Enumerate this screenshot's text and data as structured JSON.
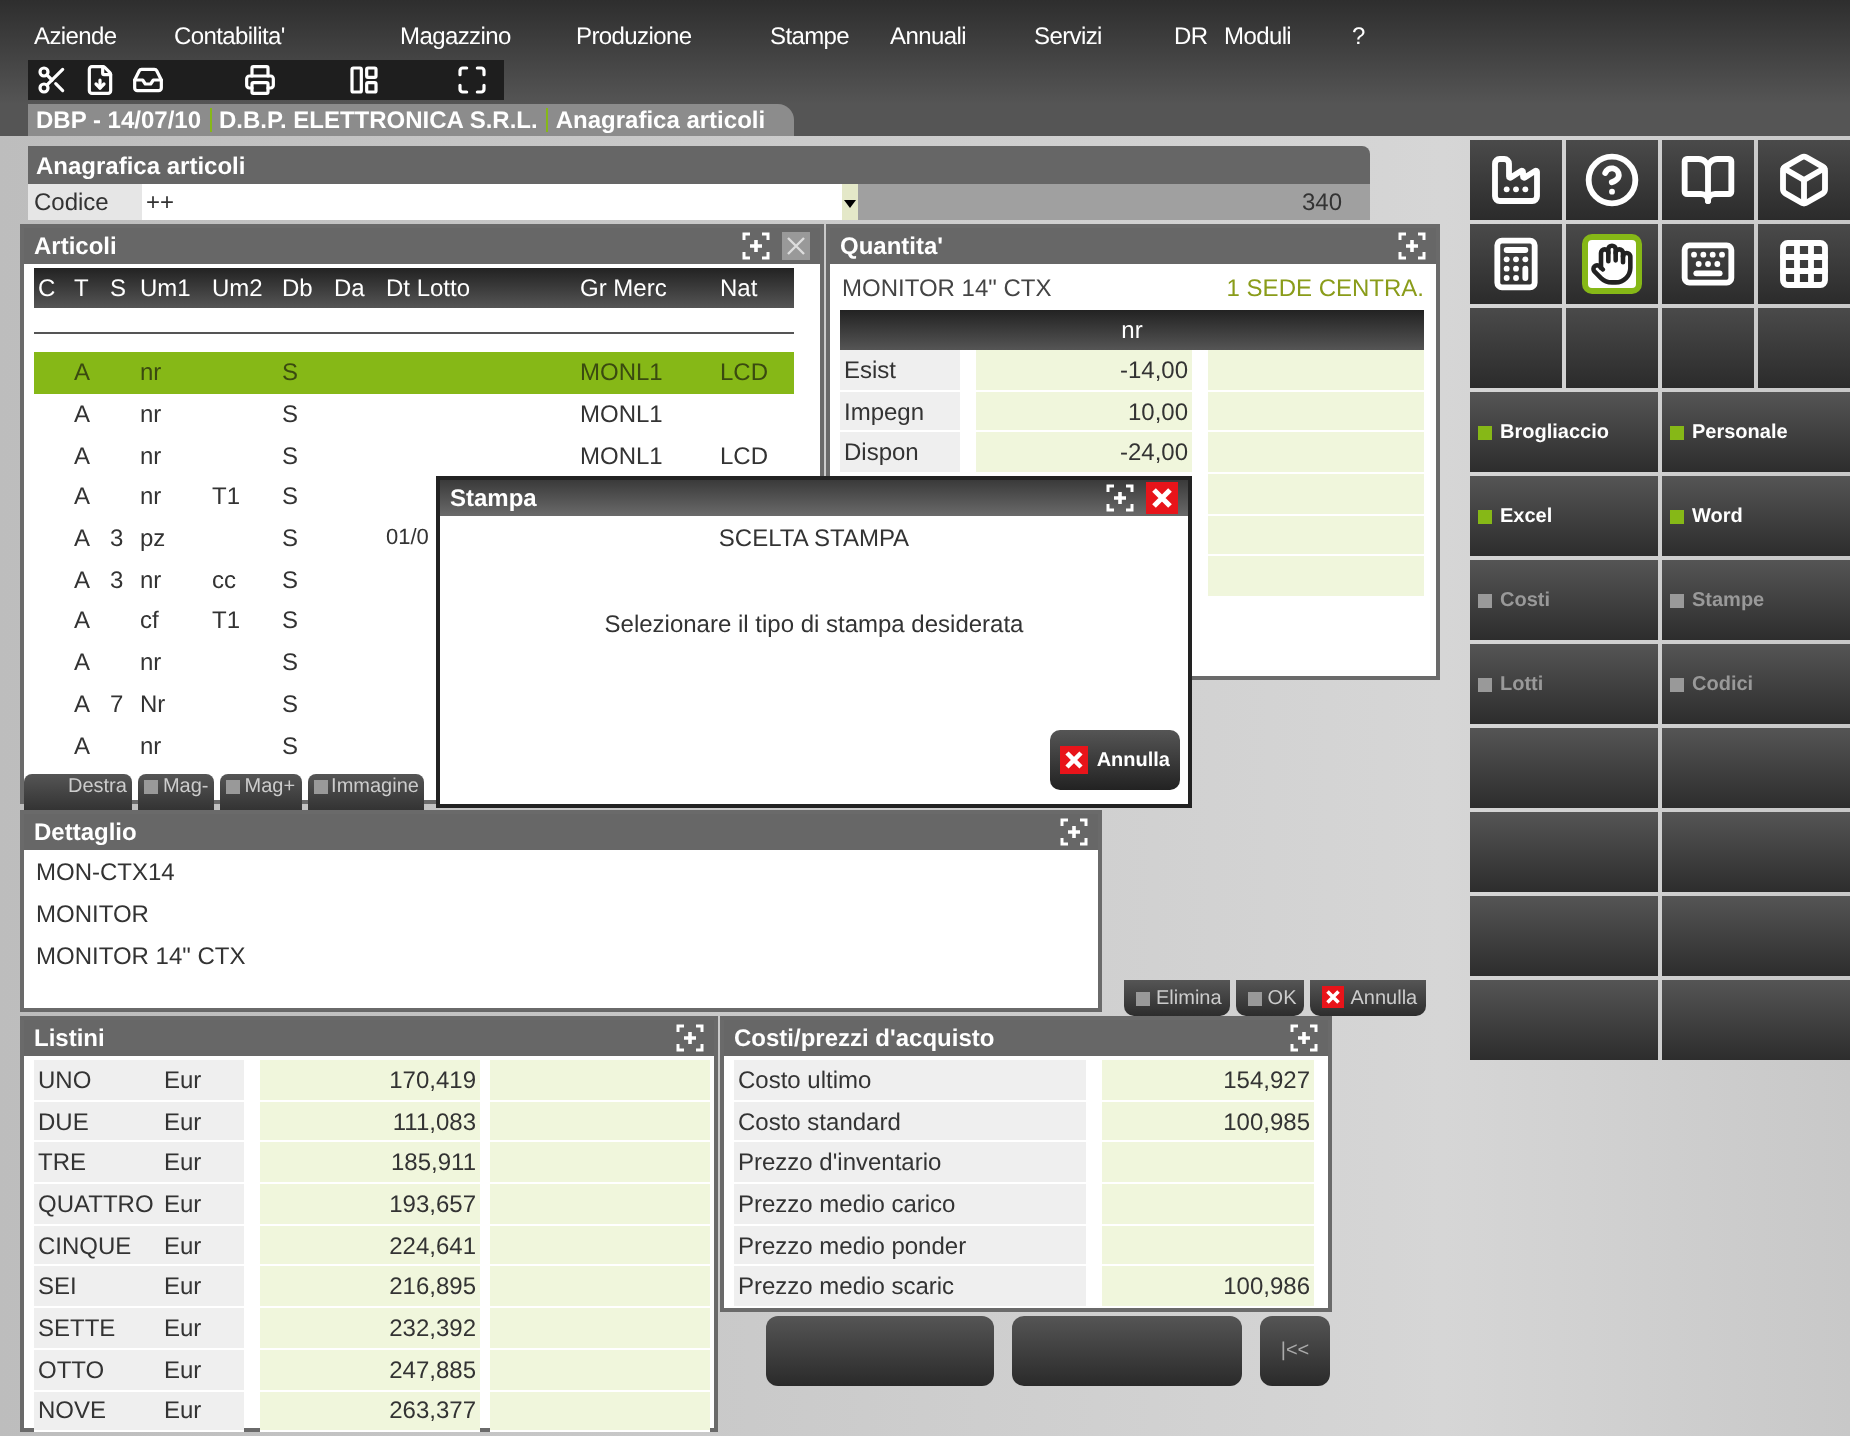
{
  "menu": [
    "Aziende",
    "Contabilita'",
    "Magazzino",
    "Produzione",
    "Stampe",
    "Annuali",
    "Servizi",
    "DR",
    "Moduli",
    "?"
  ],
  "breadcrumb": [
    "DBP - 14/07/10",
    "D.B.P. ELETTRONICA S.R.L.",
    "Anagrafica articoli"
  ],
  "form": {
    "title": "Anagrafica articoli",
    "code_label": "Codice",
    "code_value": "++",
    "count": "340"
  },
  "articoli": {
    "title": "Articoli",
    "columns": [
      "C",
      "T",
      "S",
      "Um1",
      "Um2",
      "Db",
      "Da",
      "Dt Lotto",
      "Gr Merc",
      "Nat"
    ],
    "rows": [
      {
        "selected": true,
        "cells": [
          null,
          "A",
          null,
          "nr",
          null,
          "S",
          null,
          null,
          "MONL1",
          "LCD"
        ]
      },
      {
        "selected": false,
        "cells": [
          null,
          "A",
          null,
          "nr",
          null,
          "S",
          null,
          null,
          "MONL1",
          null
        ]
      },
      {
        "selected": false,
        "cells": [
          null,
          "A",
          null,
          "nr",
          null,
          "S",
          null,
          null,
          "MONL1",
          "LCD"
        ]
      },
      {
        "selected": false,
        "cells": [
          null,
          "A",
          null,
          "nr",
          "T1",
          "S"
        ]
      },
      {
        "selected": false,
        "cells": [
          null,
          "A",
          "3",
          "pz",
          null,
          "S",
          null,
          "01/0"
        ]
      },
      {
        "selected": false,
        "cells": [
          null,
          "A",
          "3",
          "nr",
          "cc",
          "S"
        ]
      },
      {
        "selected": false,
        "cells": [
          null,
          "A",
          null,
          "cf",
          "T1",
          "S"
        ]
      },
      {
        "selected": false,
        "cells": [
          null,
          "A",
          null,
          "nr",
          null,
          "S"
        ]
      },
      {
        "selected": false,
        "cells": [
          null,
          "A",
          "7",
          "Nr",
          null,
          "S"
        ]
      },
      {
        "selected": false,
        "cells": [
          null,
          "A",
          null,
          "nr",
          null,
          "S"
        ]
      }
    ],
    "buttons": [
      {
        "label": "Destra",
        "kind": "plain"
      },
      {
        "label": "Mag-",
        "kind": "check"
      },
      {
        "label": "Mag+",
        "kind": "check"
      },
      {
        "label": "Immagine",
        "kind": "check"
      }
    ]
  },
  "quantita": {
    "title": "Quantita'",
    "product": "MONITOR 14\" CTX",
    "store": "1 SEDE CENTRA.",
    "unit": "nr",
    "rows": [
      {
        "label": "Esist",
        "value": "-14,00"
      },
      {
        "label": "Impegn",
        "value": "10,00"
      },
      {
        "label": "Dispon",
        "value": "-24,00"
      }
    ]
  },
  "dialog": {
    "title": "Stampa",
    "heading": "SCELTA STAMPA",
    "message": "Selezionare il tipo di stampa desiderata",
    "button": "Annulla"
  },
  "dettaglio": {
    "title": "Dettaglio",
    "lines": [
      "MON-CTX14",
      "MONITOR",
      "MONITOR 14\" CTX"
    ]
  },
  "action_buttons": [
    {
      "label": "Elimina",
      "kind": "check"
    },
    {
      "label": "OK",
      "kind": "check"
    },
    {
      "label": "Annulla",
      "kind": "cancel"
    }
  ],
  "listini": {
    "title": "Listini",
    "rows": [
      {
        "name": "UNO",
        "currency": "Eur",
        "value": "170,419"
      },
      {
        "name": "DUE",
        "currency": "Eur",
        "value": "111,083"
      },
      {
        "name": "TRE",
        "currency": "Eur",
        "value": "185,911"
      },
      {
        "name": "QUATTRO",
        "currency": "Eur",
        "value": "193,657"
      },
      {
        "name": "CINQUE",
        "currency": "Eur",
        "value": "224,641"
      },
      {
        "name": "SEI",
        "currency": "Eur",
        "value": "216,895"
      },
      {
        "name": "SETTE",
        "currency": "Eur",
        "value": "232,392"
      },
      {
        "name": "OTTO",
        "currency": "Eur",
        "value": "247,885"
      },
      {
        "name": "NOVE",
        "currency": "Eur",
        "value": "263,377"
      }
    ]
  },
  "costi": {
    "title": "Costi/prezzi d'acquisto",
    "rows": [
      {
        "label": "Costo ultimo",
        "value": "154,927"
      },
      {
        "label": "Costo standard",
        "value": "100,985"
      },
      {
        "label": "Prezzo d'inventario"
      },
      {
        "label": "Prezzo medio carico"
      },
      {
        "label": "Prezzo medio ponder"
      },
      {
        "label": "Prezzo medio scaric",
        "value": "100,986"
      }
    ]
  },
  "nav_button": "|<<",
  "tool_buttons": [
    {
      "selected": false
    },
    {
      "selected": false
    },
    {
      "selected": false
    },
    {
      "selected": false
    },
    {
      "selected": false
    },
    {
      "selected": true
    },
    {
      "selected": false
    },
    {
      "selected": false
    }
  ],
  "side_buttons": [
    {
      "label": "Brogliaccio",
      "disabled": false
    },
    {
      "label": "Personale",
      "disabled": false
    },
    {
      "label": "Excel",
      "disabled": false
    },
    {
      "label": "Word",
      "disabled": false
    },
    {
      "label": "Costi",
      "disabled": true
    },
    {
      "label": "Stampe",
      "disabled": true
    },
    {
      "label": "Lotti",
      "disabled": true
    },
    {
      "label": "Codici",
      "disabled": true
    }
  ]
}
